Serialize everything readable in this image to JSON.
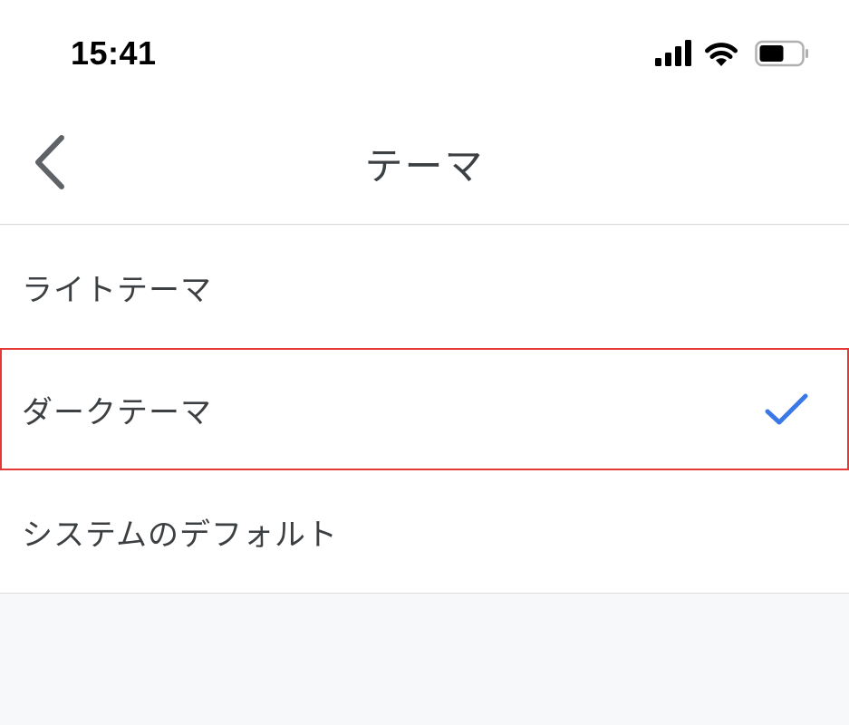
{
  "status_bar": {
    "time": "15:41",
    "icons": [
      "cellular-signal-icon",
      "wifi-icon",
      "battery-icon"
    ]
  },
  "nav": {
    "back_icon": "chevron-left-icon",
    "title": "テーマ"
  },
  "options": [
    {
      "label": "ライトテーマ",
      "selected": false
    },
    {
      "label": "ダークテーマ",
      "selected": true
    },
    {
      "label": "システムのデフォルト",
      "selected": false
    }
  ],
  "colors": {
    "accent": "#3b78e7",
    "highlight_border": "#e53935",
    "text": "#3c4043",
    "divider": "#dadce0",
    "footer_bg": "#f7f8fa"
  }
}
